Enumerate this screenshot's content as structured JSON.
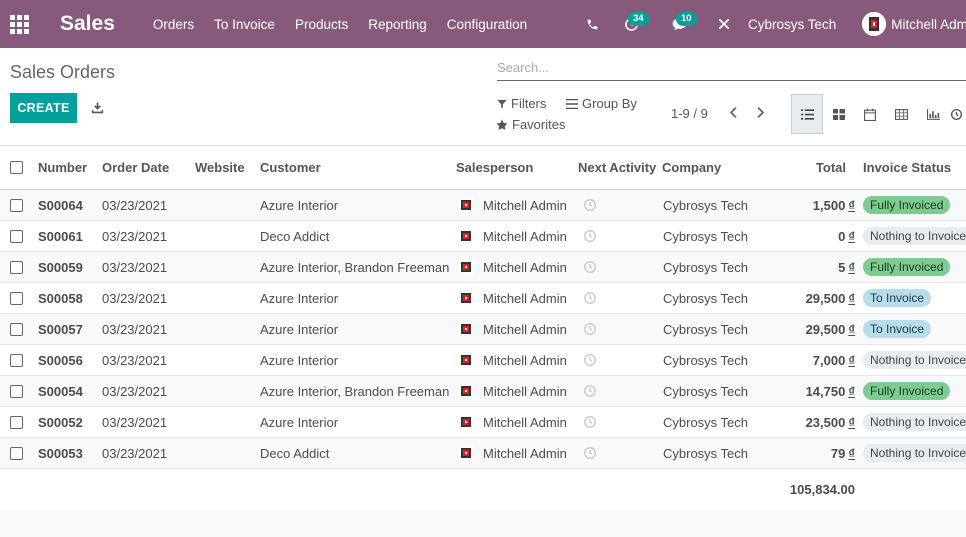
{
  "nav": {
    "app_name": "Sales",
    "menu": [
      "Orders",
      "To Invoice",
      "Products",
      "Reporting",
      "Configuration"
    ],
    "activity_count": "34",
    "message_count": "10",
    "company": "Cybrosys Tech",
    "user": "Mitchell Admin"
  },
  "control": {
    "title": "Sales Orders",
    "create_label": "CREATE",
    "search_placeholder": "Search...",
    "filters_label": "Filters",
    "group_by_label": "Group By",
    "favorites_label": "Favorites",
    "pager": "1-9 / 9"
  },
  "table": {
    "columns": [
      "Number",
      "Order Date",
      "Website",
      "Customer",
      "Salesperson",
      "Next Activity",
      "Company",
      "Total",
      "Invoice Status"
    ],
    "rows": [
      {
        "number": "S00064",
        "date": "03/23/2021",
        "website": "",
        "customer": "Azure Interior",
        "salesperson": "Mitchell Admin",
        "company": "Cybrosys Tech",
        "total": "1,500",
        "currency": "₫",
        "status": "Fully Invoiced",
        "status_color": "#7dcb91"
      },
      {
        "number": "S00061",
        "date": "03/23/2021",
        "website": "",
        "customer": "Deco Addict",
        "salesperson": "Mitchell Admin",
        "company": "Cybrosys Tech",
        "total": "0",
        "currency": "₫",
        "status": "Nothing to Invoice",
        "status_color": "#e9ecef"
      },
      {
        "number": "S00059",
        "date": "03/23/2021",
        "website": "",
        "customer": "Azure Interior, Brandon Freeman",
        "salesperson": "Mitchell Admin",
        "company": "Cybrosys Tech",
        "total": "5",
        "currency": "₫",
        "status": "Fully Invoiced",
        "status_color": "#7dcb91"
      },
      {
        "number": "S00058",
        "date": "03/23/2021",
        "website": "",
        "customer": "Azure Interior",
        "salesperson": "Mitchell Admin",
        "company": "Cybrosys Tech",
        "total": "29,500",
        "currency": "₫",
        "status": "To Invoice",
        "status_color": "#b9dcea"
      },
      {
        "number": "S00057",
        "date": "03/23/2021",
        "website": "",
        "customer": "Azure Interior",
        "salesperson": "Mitchell Admin",
        "company": "Cybrosys Tech",
        "total": "29,500",
        "currency": "₫",
        "status": "To Invoice",
        "status_color": "#b9dcea"
      },
      {
        "number": "S00056",
        "date": "03/23/2021",
        "website": "",
        "customer": "Azure Interior",
        "salesperson": "Mitchell Admin",
        "company": "Cybrosys Tech",
        "total": "7,000",
        "currency": "₫",
        "status": "Nothing to Invoice",
        "status_color": "#e9ecef"
      },
      {
        "number": "S00054",
        "date": "03/23/2021",
        "website": "",
        "customer": "Azure Interior, Brandon Freeman",
        "salesperson": "Mitchell Admin",
        "company": "Cybrosys Tech",
        "total": "14,750",
        "currency": "₫",
        "status": "Fully Invoiced",
        "status_color": "#7dcb91"
      },
      {
        "number": "S00052",
        "date": "03/23/2021",
        "website": "",
        "customer": "Azure Interior",
        "salesperson": "Mitchell Admin",
        "company": "Cybrosys Tech",
        "total": "23,500",
        "currency": "₫",
        "status": "Nothing to Invoice",
        "status_color": "#e9ecef"
      },
      {
        "number": "S00053",
        "date": "03/23/2021",
        "website": "",
        "customer": "Deco Addict",
        "salesperson": "Mitchell Admin",
        "company": "Cybrosys Tech",
        "total": "79",
        "currency": "₫",
        "status": "Nothing to Invoice",
        "status_color": "#e9ecef"
      }
    ],
    "grand_total": "105,834.00"
  },
  "colors": {
    "nav_bg": "#875a7b",
    "primary": "#00a09d"
  }
}
